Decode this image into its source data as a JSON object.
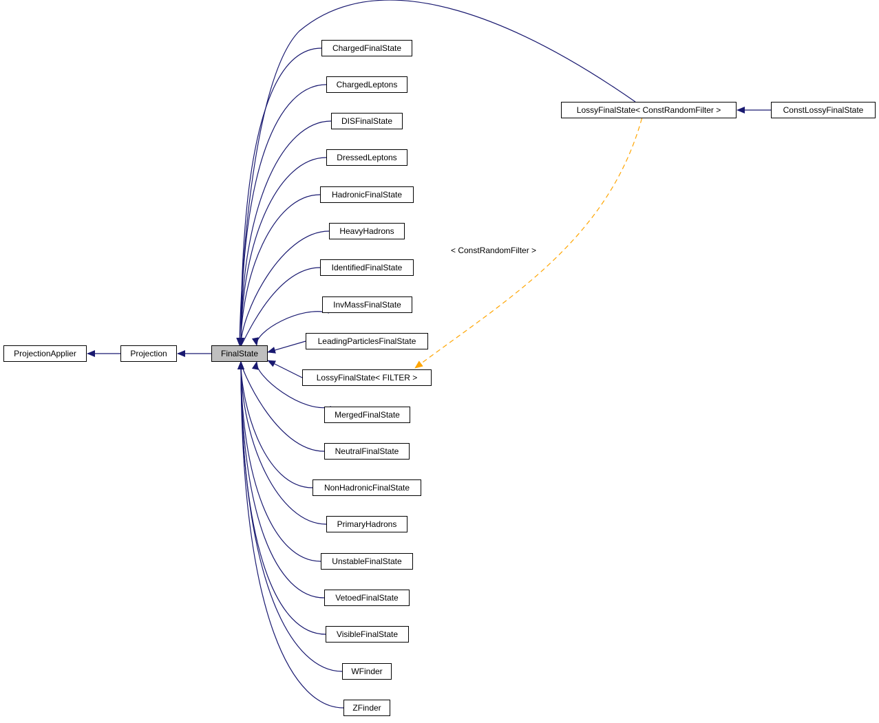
{
  "diagram": {
    "type": "class-inheritance-graph",
    "focus_node": "FinalState",
    "colors": {
      "inheritance_edge": "#191970",
      "template_edge": "#ffa500",
      "focus_fill": "#bfbfbf",
      "node_fill": "#ffffff",
      "node_border": "#000000"
    },
    "nodes": {
      "projection_applier": "ProjectionApplier",
      "projection": "Projection",
      "final_state": "FinalState",
      "children": [
        "ChargedFinalState",
        "ChargedLeptons",
        "DISFinalState",
        "DressedLeptons",
        "HadronicFinalState",
        "HeavyHadrons",
        "IdentifiedFinalState",
        "InvMassFinalState",
        "LeadingParticlesFinalState",
        "LossyFinalState< FILTER >",
        "MergedFinalState",
        "NeutralFinalState",
        "NonHadronicFinalState",
        "PrimaryHadrons",
        "UnstableFinalState",
        "VetoedFinalState",
        "VisibleFinalState",
        "WFinder",
        "ZFinder"
      ],
      "lossy_const": "LossyFinalState< ConstRandomFilter >",
      "const_lossy": "ConstLossyFinalState"
    },
    "edges": [
      {
        "from": "Projection",
        "to": "ProjectionApplier",
        "kind": "inheritance"
      },
      {
        "from": "FinalState",
        "to": "Projection",
        "kind": "inheritance"
      },
      {
        "from": "ChargedFinalState",
        "to": "FinalState",
        "kind": "inheritance"
      },
      {
        "from": "ChargedLeptons",
        "to": "FinalState",
        "kind": "inheritance"
      },
      {
        "from": "DISFinalState",
        "to": "FinalState",
        "kind": "inheritance"
      },
      {
        "from": "DressedLeptons",
        "to": "FinalState",
        "kind": "inheritance"
      },
      {
        "from": "HadronicFinalState",
        "to": "FinalState",
        "kind": "inheritance"
      },
      {
        "from": "HeavyHadrons",
        "to": "FinalState",
        "kind": "inheritance"
      },
      {
        "from": "IdentifiedFinalState",
        "to": "FinalState",
        "kind": "inheritance"
      },
      {
        "from": "InvMassFinalState",
        "to": "FinalState",
        "kind": "inheritance"
      },
      {
        "from": "LeadingParticlesFinalState",
        "to": "FinalState",
        "kind": "inheritance"
      },
      {
        "from": "LossyFinalState< FILTER >",
        "to": "FinalState",
        "kind": "inheritance"
      },
      {
        "from": "MergedFinalState",
        "to": "FinalState",
        "kind": "inheritance"
      },
      {
        "from": "NeutralFinalState",
        "to": "FinalState",
        "kind": "inheritance"
      },
      {
        "from": "NonHadronicFinalState",
        "to": "FinalState",
        "kind": "inheritance"
      },
      {
        "from": "PrimaryHadrons",
        "to": "FinalState",
        "kind": "inheritance"
      },
      {
        "from": "UnstableFinalState",
        "to": "FinalState",
        "kind": "inheritance"
      },
      {
        "from": "VetoedFinalState",
        "to": "FinalState",
        "kind": "inheritance"
      },
      {
        "from": "VisibleFinalState",
        "to": "FinalState",
        "kind": "inheritance"
      },
      {
        "from": "WFinder",
        "to": "FinalState",
        "kind": "inheritance"
      },
      {
        "from": "ZFinder",
        "to": "FinalState",
        "kind": "inheritance"
      },
      {
        "from": "LossyFinalState< ConstRandomFilter >",
        "to": "FinalState",
        "kind": "inheritance"
      },
      {
        "from": "ConstLossyFinalState",
        "to": "LossyFinalState< ConstRandomFilter >",
        "kind": "inheritance"
      },
      {
        "from": "LossyFinalState< ConstRandomFilter >",
        "to": "LossyFinalState< FILTER >",
        "kind": "template-instance",
        "label": "< ConstRandomFilter >"
      }
    ],
    "template_label": "< ConstRandomFilter >"
  }
}
